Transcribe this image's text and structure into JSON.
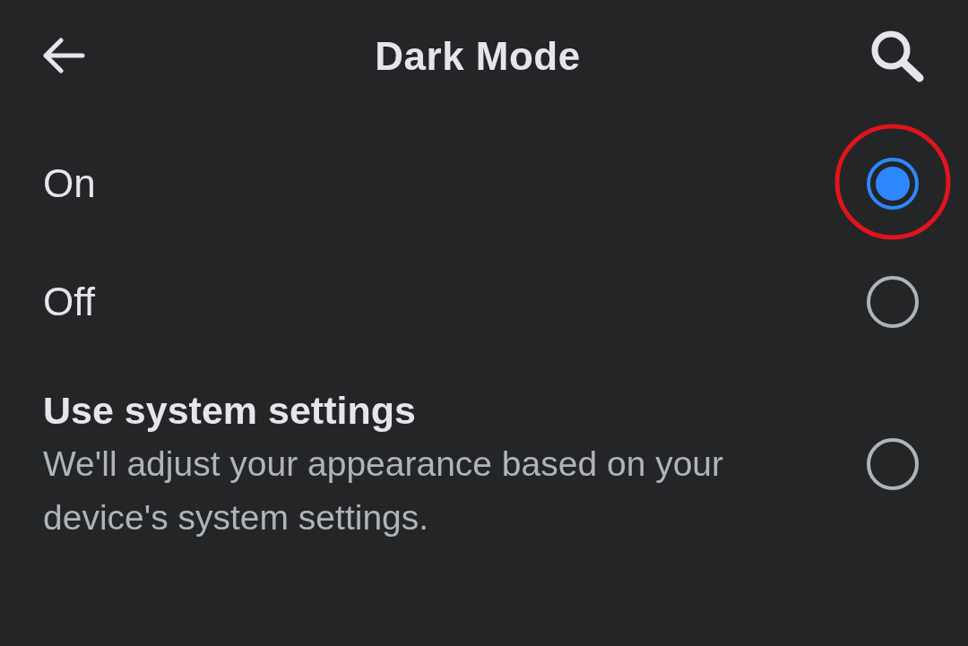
{
  "header": {
    "title": "Dark Mode"
  },
  "options": [
    {
      "label": "On",
      "selected": true,
      "highlighted": true
    },
    {
      "label": "Off",
      "selected": false,
      "highlighted": false
    },
    {
      "label": "Use system settings",
      "description": "We'll adjust your appearance based on your device's system settings.",
      "selected": false,
      "highlighted": false
    }
  ]
}
